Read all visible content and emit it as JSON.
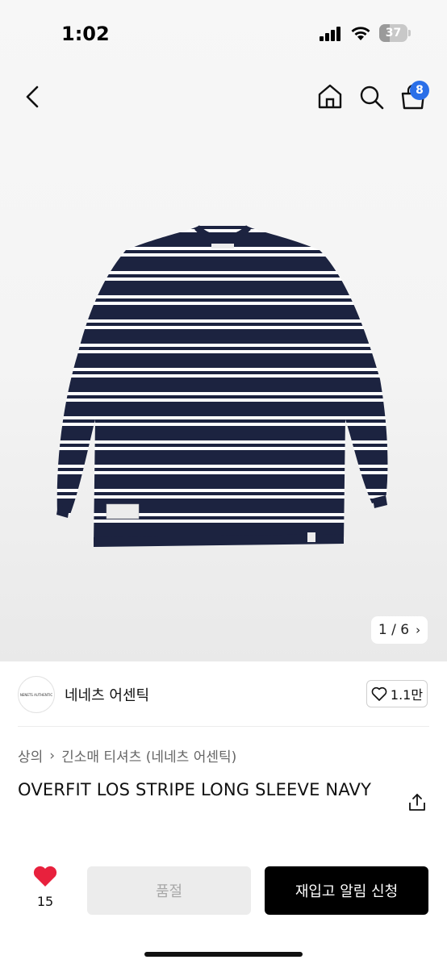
{
  "status_bar": {
    "time": "1:02",
    "battery": "37",
    "battery_level": 0.37
  },
  "nav": {
    "cart_count": "8"
  },
  "gallery": {
    "counter": "1 / 6",
    "chevron": "›",
    "garment_colors": {
      "body": "#1c2340",
      "stripe": "#ffffff"
    }
  },
  "brand": {
    "name": "네네츠 어센틱",
    "likes": "1.1만"
  },
  "breadcrumb": {
    "root": "상의",
    "separator": "›",
    "category": "긴소매 티셔츠 (네네츠 어센틱)"
  },
  "product": {
    "title": "OVERFIT LOS STRIPE LONG SLEEVE NAVY"
  },
  "actions": {
    "favorite_count": "15",
    "sold_out_label": "품절",
    "notify_label": "재입고 알림 신청"
  },
  "colors": {
    "accent_badge": "#2a6fe8",
    "heart": "#e8213d",
    "primary_button": "#000000"
  }
}
